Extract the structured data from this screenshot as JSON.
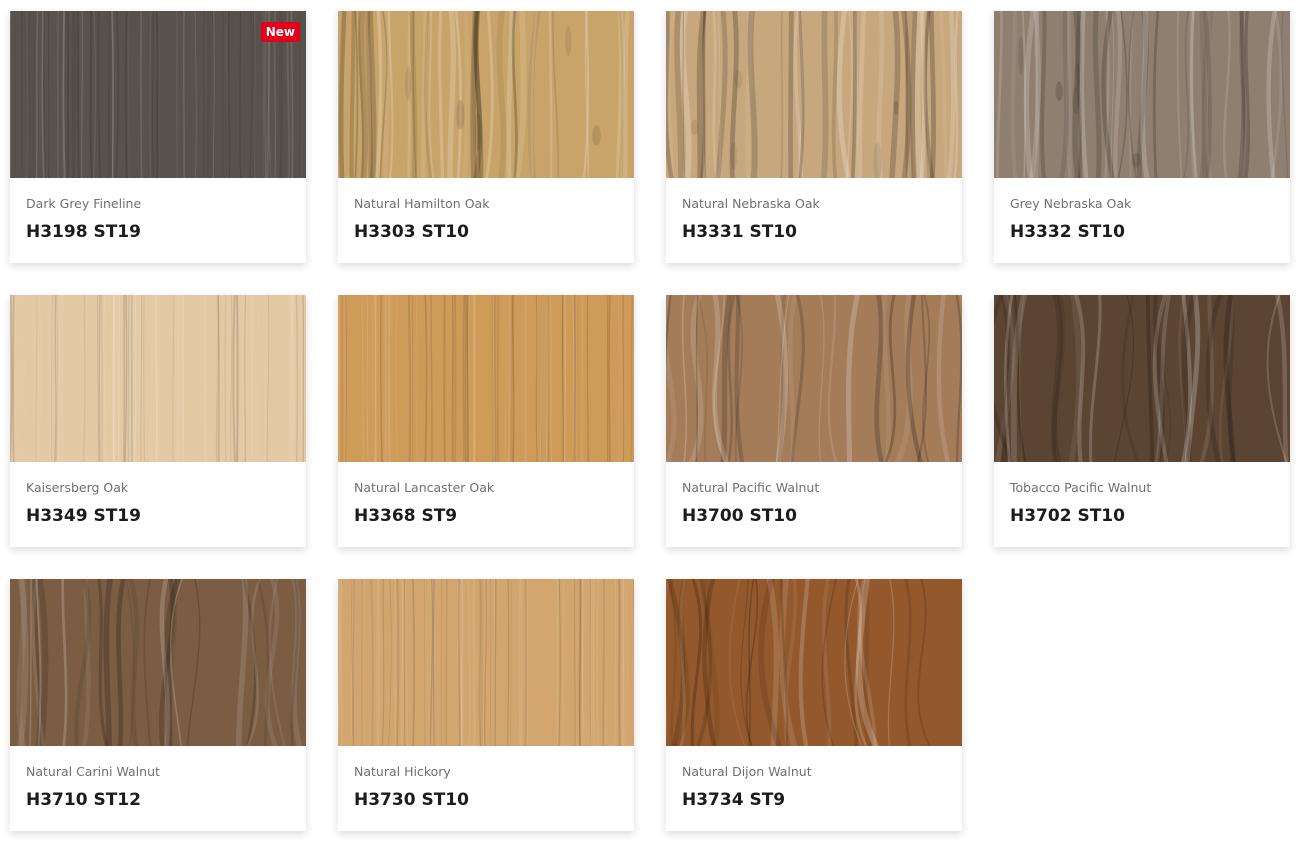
{
  "badge_label": "New",
  "cards": [
    {
      "name": "Dark Grey Fineline",
      "code": "H3198 ST19",
      "color": "#58524d",
      "grain": "fine",
      "badge": true
    },
    {
      "name": "Natural Hamilton Oak",
      "code": "H3303 ST10",
      "color": "#c9a46a",
      "grain": "oak"
    },
    {
      "name": "Natural Nebraska Oak",
      "code": "H3331 ST10",
      "color": "#c7a77d",
      "grain": "oak"
    },
    {
      "name": "Grey Nebraska Oak",
      "code": "H3332 ST10",
      "color": "#8e7f70",
      "grain": "oak"
    },
    {
      "name": "Kaisersberg Oak",
      "code": "H3349 ST19",
      "color": "#e3c9a4",
      "grain": "fine"
    },
    {
      "name": "Natural Lancaster Oak",
      "code": "H3368 ST9",
      "color": "#cf9b58",
      "grain": "fine"
    },
    {
      "name": "Natural Pacific Walnut",
      "code": "H3700 ST10",
      "color": "#a47c5a",
      "grain": "walnut"
    },
    {
      "name": "Tobacco Pacific Walnut",
      "code": "H3702 ST10",
      "color": "#5c4432",
      "grain": "walnut"
    },
    {
      "name": "Natural Carini Walnut",
      "code": "H3710 ST12",
      "color": "#7b5d44",
      "grain": "walnut"
    },
    {
      "name": "Natural Hickory",
      "code": "H3730 ST10",
      "color": "#d2a66e",
      "grain": "fine"
    },
    {
      "name": "Natural Dijon Walnut",
      "code": "H3734 ST9",
      "color": "#93582c",
      "grain": "walnut"
    }
  ]
}
